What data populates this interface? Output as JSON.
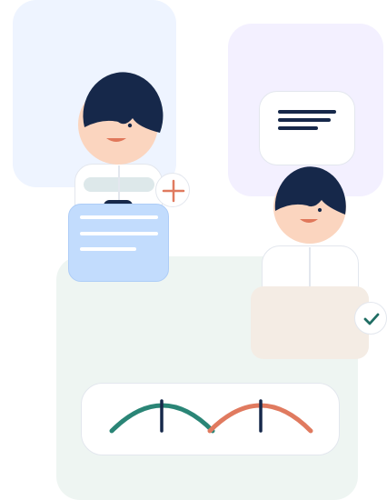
{
  "illustration": {
    "panels": [
      "light-blue",
      "lavender",
      "mint"
    ],
    "colors": {
      "navy": "#16284a",
      "skin": "#fbd5bf",
      "mouth": "#e0775a",
      "doc_blue": "#c2dcfd",
      "beige": "#f4ece4",
      "teal_arc": "#2a8576",
      "orange_arc": "#e07a5f",
      "check": "#1f6d63",
      "plus": "#e07a5f"
    },
    "icons": [
      "plus-icon",
      "check-icon",
      "text-lines-icon",
      "document-icon"
    ]
  }
}
